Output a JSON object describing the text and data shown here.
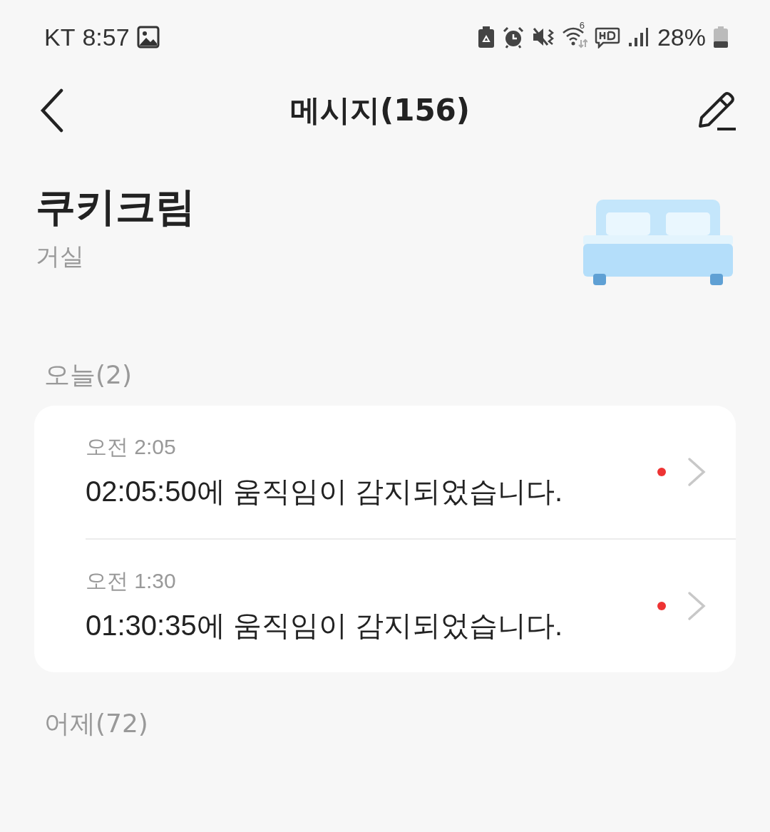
{
  "status_bar": {
    "carrier": "KT",
    "time": "8:57",
    "wifi_label": "6",
    "battery_text": "28%",
    "icons": [
      {
        "kind": "image"
      },
      {
        "kind": "battery-saver"
      },
      {
        "kind": "alarm"
      },
      {
        "kind": "mute"
      },
      {
        "kind": "wifi"
      },
      {
        "kind": "hd"
      },
      {
        "kind": "signal"
      }
    ]
  },
  "header": {
    "title": "메시지(156)"
  },
  "device": {
    "name": "쿠키크림",
    "room": "거실"
  },
  "sections": [
    {
      "label": "오늘(2)",
      "messages": [
        {
          "time": "오전 2:05",
          "text": "02:05:50에 움직임이 감지되었습니다.",
          "unread": true
        },
        {
          "time": "오전 1:30",
          "text": "01:30:35에 움직임이 감지되었습니다.",
          "unread": true
        }
      ]
    },
    {
      "label": "어제(72)"
    }
  ]
}
